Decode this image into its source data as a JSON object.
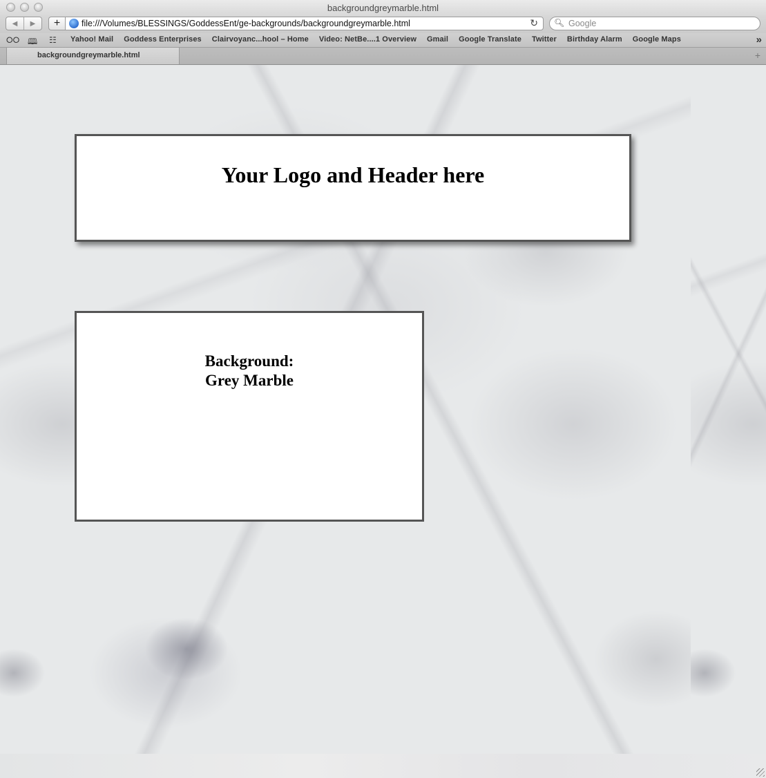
{
  "window": {
    "title": "backgroundgreymarble.html"
  },
  "toolbar": {
    "back_icon": "◀",
    "forward_icon": "▶",
    "add_icon": "+",
    "url": "file:///Volumes/BLESSINGS/GoddessEnt/ge-backgrounds/backgroundgreymarble.html",
    "reload_icon": "↻",
    "search_placeholder": "Google"
  },
  "bookmarks": {
    "reading_list_icon": "reading-glasses",
    "bookmarks_icon": "open-book",
    "top_sites_icon": "grid",
    "items": [
      "Yahoo! Mail",
      "Goddess Enterprises",
      "Clairvoyanc...hool – Home",
      "Video: NetBe....1 Overview",
      "Gmail",
      "Google Translate",
      "Twitter",
      "Birthday Alarm",
      "Google Maps"
    ],
    "more_icon": "»"
  },
  "tabs": [
    {
      "label": "backgroundgreymarble.html",
      "active": true
    }
  ],
  "page": {
    "background_name": "grey marble",
    "header_text": "Your Logo and Header here",
    "content_line1": "Background:",
    "content_line2": "Grey Marble",
    "colors": {
      "box_border": "#555555",
      "box_fill": "#ffffff",
      "marble_base": "#e7e9ea"
    }
  }
}
